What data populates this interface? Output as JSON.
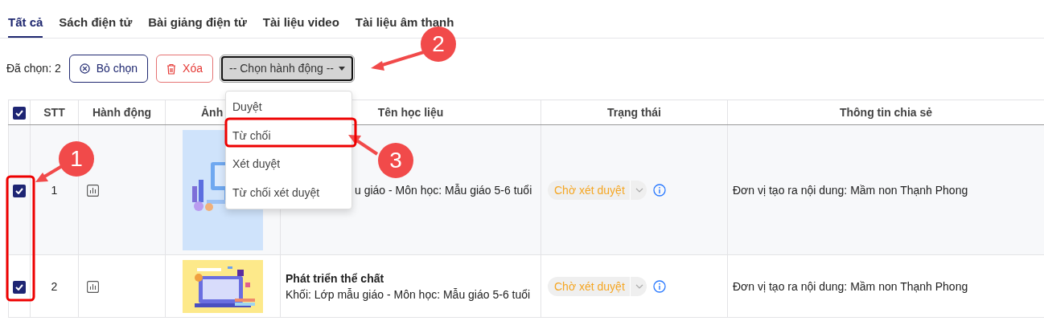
{
  "tabs": [
    {
      "label": "Tất cả",
      "selected": true
    },
    {
      "label": "Sách điện tử",
      "selected": false
    },
    {
      "label": "Bài giảng điện tử",
      "selected": false
    },
    {
      "label": "Tài liệu video",
      "selected": false
    },
    {
      "label": "Tài liệu âm thanh",
      "selected": false
    }
  ],
  "toolbar": {
    "selected_count": "Đã chọn: 2",
    "buttons": [
      {
        "label": "Bỏ chọn",
        "kind": "deselect"
      },
      {
        "label": "Xóa",
        "kind": "delete"
      }
    ],
    "action_select": {
      "value": "-- Chọn hành động --",
      "expanded": true,
      "options": [
        {
          "label": "Duyệt"
        },
        {
          "label": "Từ chối"
        },
        {
          "label": "Xét duyệt"
        },
        {
          "label": "Từ chối xét duyệt"
        }
      ]
    }
  },
  "table": {
    "select_all_checked": true,
    "columns": [
      "STT",
      "Hành động",
      "Ảnh",
      "Tên học liệu",
      "Trạng thái",
      "Thông tin chia sẻ"
    ],
    "rows": [
      {
        "checked": true,
        "stt": "1",
        "description": "u giáo - Môn học: Mẫu giáo 5-6 tuổi",
        "status": "Chờ xét duyệt",
        "sharing": "Đơn vị tạo ra nội dung: Mầm non Thạnh Phong"
      },
      {
        "checked": true,
        "stt": "2",
        "title": "Phát triển thể chất",
        "description": "Khối: Lớp mẫu giáo - Môn học: Mẫu giáo 5-6 tuổi",
        "status": "Chờ xét duyệt",
        "sharing": "Đơn vị tạo ra nội dung: Mầm non Thạnh Phong"
      }
    ]
  },
  "annotations": [
    {
      "label": "1"
    },
    {
      "label": "2"
    },
    {
      "label": "3"
    }
  ]
}
